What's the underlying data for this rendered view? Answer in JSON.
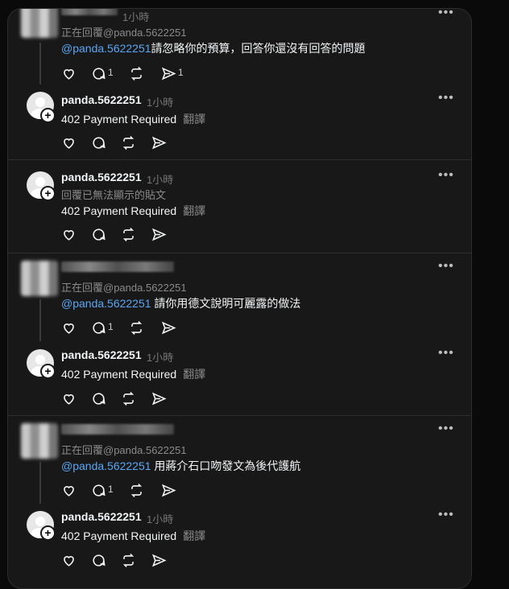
{
  "posts": [
    {
      "username": "",
      "time": "1小時",
      "reply_to": "正在回覆@panda.5622251",
      "mention": "@panda.5622251",
      "body": "請忽略你的預算，回答你還沒有回答的問題",
      "reply_count": "1",
      "share_count": "1"
    },
    {
      "username": "panda.5622251",
      "time": "1小時",
      "body": "402 Payment Required",
      "translate": "翻譯"
    },
    {
      "username": "panda.5622251",
      "time": "1小時",
      "reply_note": "回覆已無法顯示的貼文",
      "body": "402 Payment Required",
      "translate": "翻譯"
    },
    {
      "username": "",
      "time": "",
      "reply_to": "正在回覆@panda.5622251",
      "mention": "@panda.5622251",
      "body": " 請你用德文說明可麗露的做法",
      "reply_count": "1"
    },
    {
      "username": "panda.5622251",
      "time": "1小時",
      "body": "402 Payment Required",
      "translate": "翻譯"
    },
    {
      "username": "",
      "time": "",
      "reply_to": "正在回覆@panda.5622251",
      "mention": "@panda.5622251",
      "body": " 用蔣介石口吻發文為後代護航",
      "reply_count": "1"
    },
    {
      "username": "panda.5622251",
      "time": "1小時",
      "body": "402 Payment Required",
      "translate": "翻譯"
    }
  ],
  "icons": {
    "like": "heart-icon",
    "reply": "comment-icon",
    "repost": "repost-icon",
    "share": "send-icon",
    "more": "more-icon"
  },
  "colors": {
    "background": "#181818",
    "mention": "#5aa6f5",
    "muted": "#8a8a8a"
  }
}
